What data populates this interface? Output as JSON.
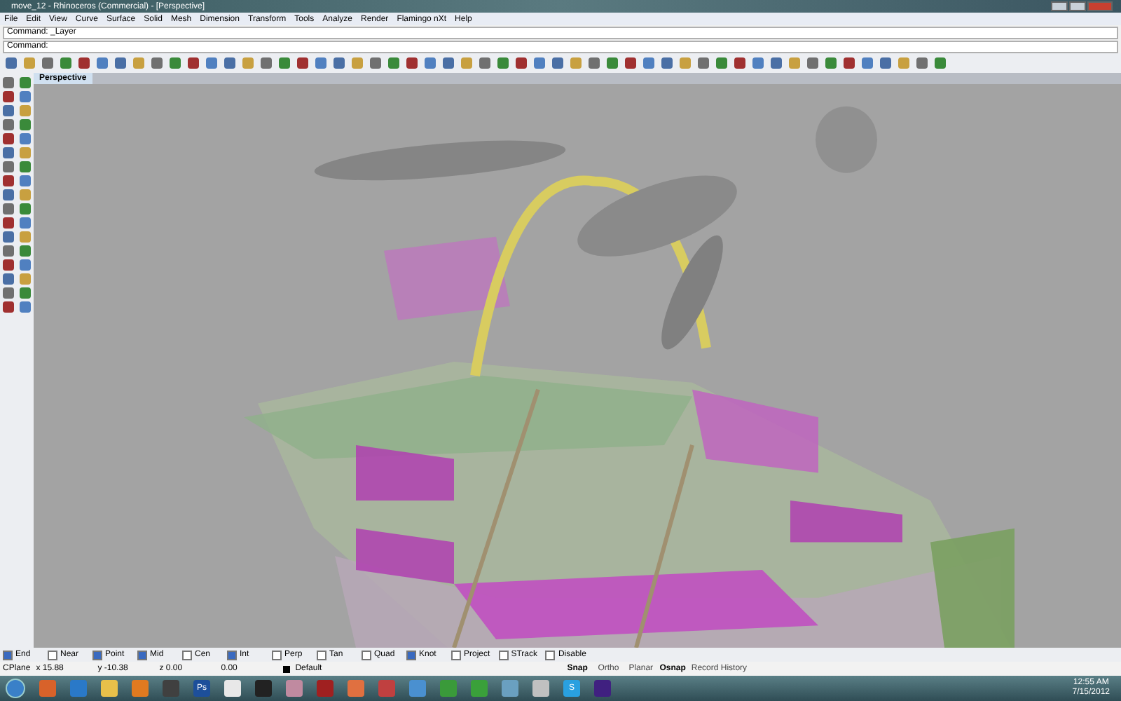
{
  "window": {
    "title": "move_12 - Rhinoceros (Commercial) - [Perspective]"
  },
  "menu": [
    "File",
    "Edit",
    "View",
    "Curve",
    "Surface",
    "Solid",
    "Mesh",
    "Dimension",
    "Transform",
    "Tools",
    "Analyze",
    "Render",
    "Flamingo nXt",
    "Help"
  ],
  "command": {
    "history": "Command: _Layer",
    "prompt": "Command:"
  },
  "viewport_tab": {
    "label": "Perspective",
    "selected": true
  },
  "osnaps": [
    {
      "label": "End",
      "checked": true
    },
    {
      "label": "Near",
      "checked": false
    },
    {
      "label": "Point",
      "checked": true
    },
    {
      "label": "Mid",
      "checked": true
    },
    {
      "label": "Cen",
      "checked": false
    },
    {
      "label": "Int",
      "checked": true
    },
    {
      "label": "Perp",
      "checked": false
    },
    {
      "label": "Tan",
      "checked": false
    },
    {
      "label": "Quad",
      "checked": false
    },
    {
      "label": "Knot",
      "checked": true
    },
    {
      "label": "Project",
      "checked": false
    },
    {
      "label": "STrack",
      "checked": false
    },
    {
      "label": "Disable",
      "checked": false
    }
  ],
  "status": {
    "cplane": "CPlane",
    "x": "x 15.88",
    "y": "y -10.38",
    "z": "z 0.00",
    "distance": "0.00",
    "layer": "Default",
    "toggles": [
      {
        "label": "Snap",
        "on": true
      },
      {
        "label": "Ortho",
        "on": false
      },
      {
        "label": "Planar",
        "on": false
      },
      {
        "label": "Osnap",
        "on": true
      },
      {
        "label": "Record History",
        "on": false
      }
    ]
  },
  "taskbar": {
    "apps": [
      {
        "color": "#d8622a"
      },
      {
        "color": "#2a79c8"
      },
      {
        "color": "#e8c04a"
      },
      {
        "color": "#e07a20"
      },
      {
        "color": "#404040"
      },
      {
        "color": "#1d4f9a",
        "label": "Ps"
      },
      {
        "color": "#e8e8e8"
      },
      {
        "color": "#222222"
      },
      {
        "color": "#c08aa0"
      },
      {
        "color": "#a02020"
      },
      {
        "color": "#e07040"
      },
      {
        "color": "#c04040"
      },
      {
        "color": "#4a90d0"
      },
      {
        "color": "#3a9a3a"
      },
      {
        "color": "#3aa03a"
      },
      {
        "color": "#6aa0c0"
      },
      {
        "color": "#c0c0c0"
      },
      {
        "color": "#29a0e0",
        "label": "S"
      },
      {
        "color": "#402080"
      }
    ],
    "time": "12:55 AM",
    "date": "7/15/2012"
  }
}
